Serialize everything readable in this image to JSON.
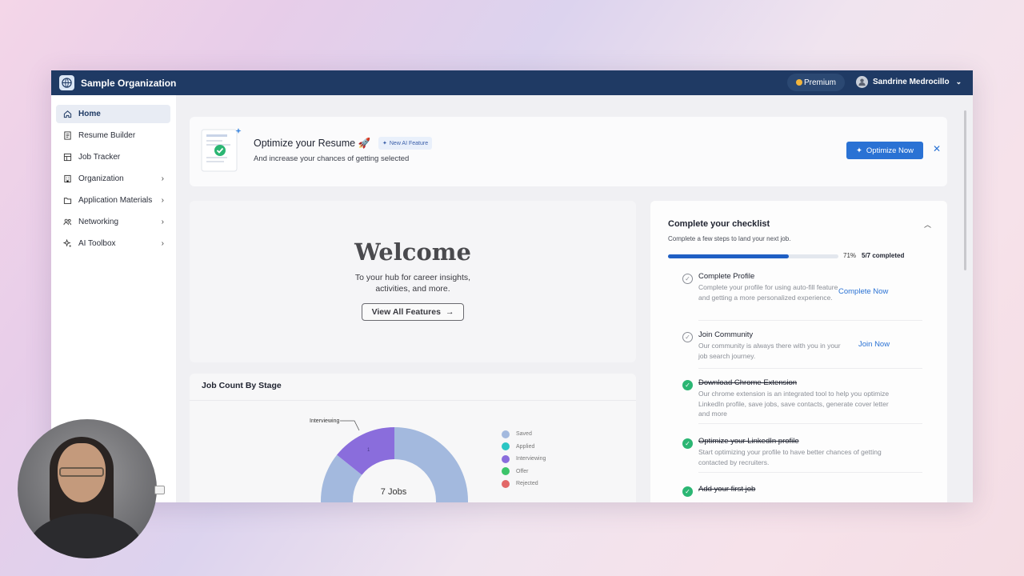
{
  "topbar": {
    "org_name": "Sample Organization",
    "premium_label": "Premium",
    "user_name": "Sandrine Medrocillo"
  },
  "sidebar": {
    "items": [
      {
        "label": "Home",
        "icon": "home-icon",
        "active": true
      },
      {
        "label": "Resume Builder",
        "icon": "document-icon"
      },
      {
        "label": "Job Tracker",
        "icon": "table-icon"
      },
      {
        "label": "Organization",
        "icon": "building-icon",
        "expandable": true
      },
      {
        "label": "Application Materials",
        "icon": "folder-icon",
        "expandable": true
      },
      {
        "label": "Networking",
        "icon": "people-icon",
        "expandable": true
      },
      {
        "label": "AI Toolbox",
        "icon": "sparkle-icon",
        "expandable": true
      }
    ]
  },
  "banner": {
    "title": "Optimize your Resume 🚀",
    "badge": "New AI Feature",
    "subtitle": "And increase your chances of getting selected",
    "button": "Optimize Now"
  },
  "welcome": {
    "title": "Welcome",
    "subtitle": "To your hub for career insights, activities, and more.",
    "button": "View All Features"
  },
  "job_count": {
    "title": "Job Count By Stage",
    "center_label": "7 Jobs",
    "callout_label": "Interviewing",
    "callout_value": "1",
    "chart_data": {
      "type": "pie",
      "categories": [
        "Saved",
        "Applied",
        "Interviewing",
        "Offer",
        "Rejected"
      ],
      "values": [
        6,
        0,
        1,
        0,
        0
      ],
      "colors": [
        "#a3b9de",
        "#2bc6c4",
        "#8a6ddc",
        "#3cc46a",
        "#e26868"
      ]
    }
  },
  "checklist": {
    "title": "Complete your checklist",
    "subtitle": "Complete a few steps to land your next job.",
    "progress": 0.71,
    "percent_label": "71%",
    "completed_label": "5/7 completed",
    "tasks": [
      {
        "title": "Complete Profile",
        "desc": "Complete your profile for using auto-fill feature and getting a more personalized experience.",
        "action": "Complete Now",
        "done": false
      },
      {
        "title": "Join Community",
        "desc": "Our community is always there with you in your job search journey.",
        "action": "Join Now",
        "done": false
      },
      {
        "title": "Download Chrome Extension",
        "desc": "Our chrome extension is an integrated tool to help you optimize LinkedIn profile, save jobs, save contacts, generate cover letter and more",
        "done": true
      },
      {
        "title": "Optimize your LinkedIn profile",
        "desc": "Start optimizing your profile to have better chances of getting contacted by recruiters.",
        "done": true
      },
      {
        "title": "Add your first job",
        "done": true
      }
    ]
  },
  "colors": {
    "topbar": "#1f3a64",
    "accent": "#2a72d4",
    "done": "#2bb673"
  }
}
